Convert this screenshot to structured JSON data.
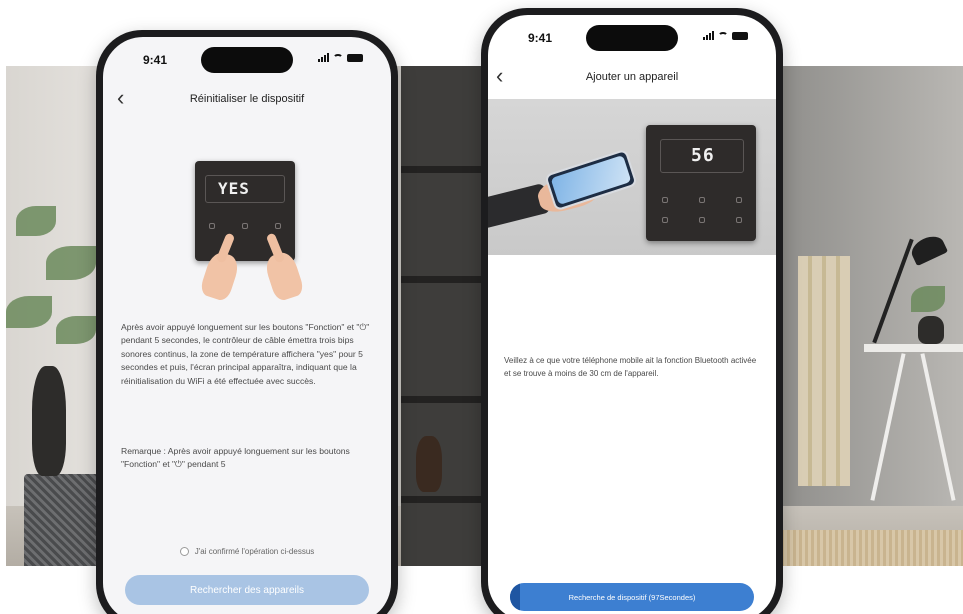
{
  "phone_left": {
    "status_time": "9:41",
    "nav_title": "Réinitialiser le dispositif",
    "device_display": "YES",
    "paragraph_1": "Après avoir appuyé longuement sur les boutons \"Fonction\" et \"⏻\" pendant 5 secondes, le contrôleur de câble émettra trois bips sonores continus, la zone de température affichera \"yes\" pour 5 secondes et puis, l'écran principal apparaîtra, indiquant que la réinitialisation du WiFi a été effectuée avec succès.",
    "paragraph_2": "Remarque : Après avoir appuyé longuement sur les boutons \"Fonction\" et \"⏻\" pendant 5",
    "confirm_label": "J'ai confirmé l'opération ci-dessus",
    "search_button_label": "Rechercher des appareils"
  },
  "phone_right": {
    "status_time": "9:41",
    "nav_title": "Ajouter un appareil",
    "device_display": "56",
    "instruction": "Veillez à ce que votre téléphone mobile ait la fonction Bluetooth activée et se trouve à moins de 30 cm de l'appareil.",
    "progress_label": "Recherche de dispositif (97Secondes)"
  },
  "colors": {
    "primary_blue": "#3d7fd1",
    "disabled_blue": "#a9c4e4"
  }
}
